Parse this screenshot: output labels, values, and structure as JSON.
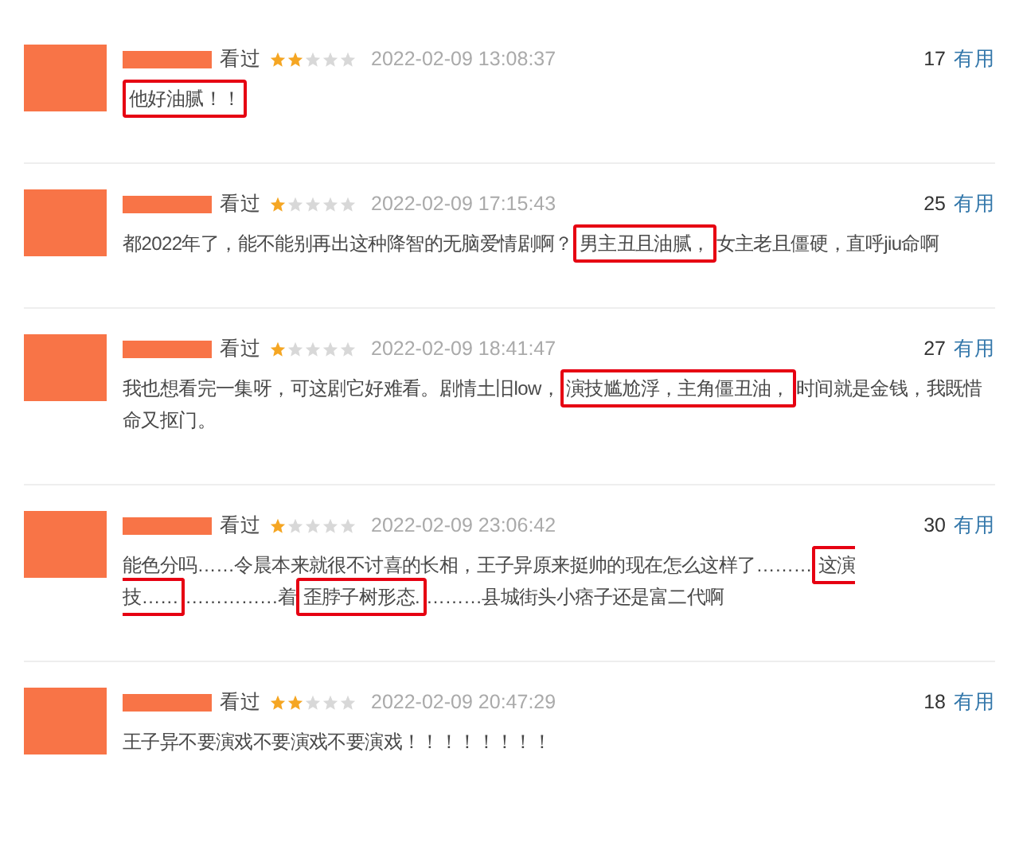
{
  "reviews": [
    {
      "status": "看过",
      "stars": 2,
      "time": "2022-02-09 13:08:37",
      "votes": "17",
      "useful": "有用",
      "segments": [
        {
          "text": "他好油腻！！",
          "highlight": true
        }
      ]
    },
    {
      "status": "看过",
      "stars": 1,
      "time": "2022-02-09 17:15:43",
      "votes": "25",
      "useful": "有用",
      "segments": [
        {
          "text": "都2022年了，能不能别再出这种降智的无脑爱情剧啊？",
          "highlight": false
        },
        {
          "text": "男主丑且油腻，",
          "highlight": true
        },
        {
          "text": "女主老且僵硬，直呼jiu命啊",
          "highlight": false
        }
      ]
    },
    {
      "status": "看过",
      "stars": 1,
      "time": "2022-02-09 18:41:47",
      "votes": "27",
      "useful": "有用",
      "segments": [
        {
          "text": "我也想看完一集呀，可这剧它好难看。剧情土旧low，",
          "highlight": false
        },
        {
          "text": "演技尴尬浮，主角僵丑油，",
          "highlight": true
        },
        {
          "text": "时间就是金钱，我既惜命又抠门。",
          "highlight": false
        }
      ]
    },
    {
      "status": "看过",
      "stars": 1,
      "time": "2022-02-09 23:06:42",
      "votes": "30",
      "useful": "有用",
      "segments": [
        {
          "text": "能色分吗……令晨本来就很不讨喜的长相，王子异原来挺帅的现在怎么这样了………",
          "highlight": false
        },
        {
          "text": "这演技……",
          "highlight": true
        },
        {
          "text": "……………着",
          "highlight": false
        },
        {
          "text": "歪脖子树形态.",
          "highlight": true
        },
        {
          "text": "………县城街头小痞子还是富二代啊",
          "highlight": false
        }
      ]
    },
    {
      "status": "看过",
      "stars": 2,
      "time": "2022-02-09 20:47:29",
      "votes": "18",
      "useful": "有用",
      "segments": [
        {
          "text": "王子异不要演戏不要演戏不要演戏！！！！！！！！",
          "highlight": false
        }
      ]
    }
  ]
}
